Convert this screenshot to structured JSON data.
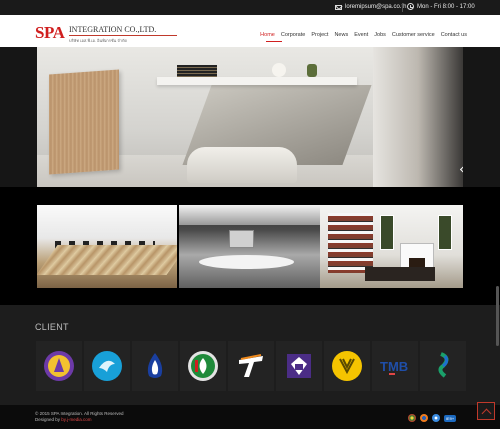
{
  "topbar": {
    "email": "loremipsum@spa.co.th",
    "hours": "Mon - Fri 8:00 - 17:00"
  },
  "logo": {
    "mark": "SPA",
    "text": "INTEGRATION CO.,LTD.",
    "thai": "บริษัท เอส.พี.เอ. อินทิเกรชั่น จำกัด"
  },
  "nav": {
    "items": [
      "Home",
      "Corporate",
      "Project",
      "News",
      "Event",
      "Jobs",
      "Customer service",
      "Contact us"
    ],
    "active": "Home"
  },
  "clients": {
    "title": "CLIENT",
    "logos": [
      {
        "name": "royal-emblem-logo",
        "color": "#6d3aa8"
      },
      {
        "name": "krungthai-bank-logo",
        "color": "#18a0d8"
      },
      {
        "name": "bangkok-bank-logo",
        "color": "#1a3fa0"
      },
      {
        "name": "kasikorn-bank-logo",
        "color": "#1f8a3a"
      },
      {
        "name": "tmb-t-logo",
        "color": "#f08a1c"
      },
      {
        "name": "siam-commercial-logo",
        "color": "#4b2d86"
      },
      {
        "name": "krungsri-logo",
        "color": "#f5c400"
      },
      {
        "name": "tmb-bank-logo",
        "color": "#1f4ea8"
      },
      {
        "name": "standard-chartered-logo",
        "color": "#1aa06a"
      }
    ],
    "tmb_text": "TMB"
  },
  "footer": {
    "copyright": "© 2015 SPA Integration. All Rights Reserved",
    "designed_by_label": "Designed by",
    "designer": "by.j-media.com",
    "ie_badge": "IE9+"
  },
  "colors": {
    "brand_red": "#d01f1f",
    "topbar_bg": "#1a1a1a",
    "section_bg": "#1d1d1d"
  }
}
